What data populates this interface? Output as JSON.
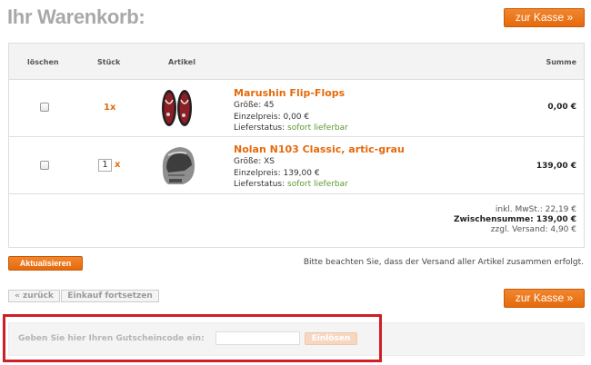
{
  "page": {
    "title": "Ihr Warenkorb:"
  },
  "buttons": {
    "checkout": "zur Kasse »",
    "update": "Aktualisieren",
    "back": "« zurück",
    "continue_shopping": "Einkauf fortsetzen"
  },
  "table": {
    "headers": {
      "remove": "löschen",
      "qty": "Stück",
      "article": "Artikel",
      "total": "Summe"
    },
    "items": [
      {
        "qty": "1x",
        "name": "Marushin Flip-Flops",
        "size": "Größe: 45",
        "unit_price": "Einzelpreis: 0,00 €",
        "status_label": "Lieferstatus:",
        "status_value": "sofort lieferbar",
        "total": "0,00 €"
      },
      {
        "qty": "1",
        "qty_suffix": "x",
        "name": "Nolan N103 Classic, artic-grau",
        "size": "Größe: XS",
        "unit_price": "Einzelpreis: 139,00 €",
        "status_label": "Lieferstatus:",
        "status_value": "sofort lieferbar",
        "total": "139,00 €"
      }
    ]
  },
  "summary": {
    "vat": "inkl. MwSt.: 22,19 €",
    "subtotal": "Zwischensumme: 139,00 €",
    "shipping": "zzgl. Versand: 4,90 €"
  },
  "notice": "Bitte beachten Sie, dass der Versand aller Artikel zusammen erfolgt.",
  "voucher": {
    "label": "Geben Sie hier Ihren Gutscheincode ein:",
    "value": "",
    "button": "Einlösen"
  },
  "colors": {
    "accent": "#e56a0c",
    "availability": "#5b9a32",
    "highlight": "#d01e25"
  }
}
